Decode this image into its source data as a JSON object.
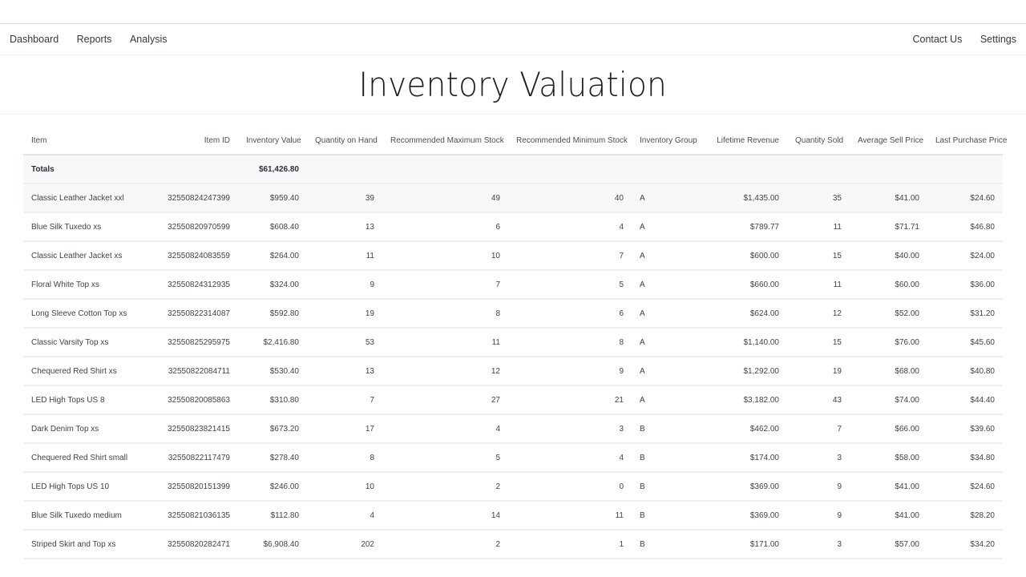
{
  "nav": {
    "left": [
      {
        "label": "Dashboard"
      },
      {
        "label": "Reports"
      },
      {
        "label": "Analysis"
      }
    ],
    "right": [
      {
        "label": "Contact Us"
      },
      {
        "label": "Settings"
      }
    ]
  },
  "page": {
    "title": "Inventory Valuation"
  },
  "table": {
    "columns": [
      "Item",
      "Item ID",
      "Inventory Value",
      "Quantity on Hand",
      "Recommended Maximum Stock",
      "Recommended Minimum Stock",
      "Inventory Group",
      "Lifetime Revenue",
      "Quantity Sold",
      "Average Sell Price",
      "Last Purchase Price"
    ],
    "totals": {
      "label": "Totals",
      "inventory_value": "$61,426.80"
    },
    "rows": [
      {
        "item": "Classic Leather Jacket xxl",
        "item_id": "32550824247399",
        "inventory_value": "$959.40",
        "qty_on_hand": "39",
        "rec_max": "49",
        "rec_min": "40",
        "group": "A",
        "lifetime_revenue": "$1,435.00",
        "qty_sold": "35",
        "avg_sell": "$41.00",
        "last_purchase": "$24.60"
      },
      {
        "item": "Blue Silk Tuxedo xs",
        "item_id": "32550820970599",
        "inventory_value": "$608.40",
        "qty_on_hand": "13",
        "rec_max": "6",
        "rec_min": "4",
        "group": "A",
        "lifetime_revenue": "$789.77",
        "qty_sold": "11",
        "avg_sell": "$71.71",
        "last_purchase": "$46.80"
      },
      {
        "item": "Classic Leather Jacket xs",
        "item_id": "32550824083559",
        "inventory_value": "$264.00",
        "qty_on_hand": "11",
        "rec_max": "10",
        "rec_min": "7",
        "group": "A",
        "lifetime_revenue": "$600.00",
        "qty_sold": "15",
        "avg_sell": "$40.00",
        "last_purchase": "$24.00"
      },
      {
        "item": "Floral White Top xs",
        "item_id": "32550824312935",
        "inventory_value": "$324.00",
        "qty_on_hand": "9",
        "rec_max": "7",
        "rec_min": "5",
        "group": "A",
        "lifetime_revenue": "$660.00",
        "qty_sold": "11",
        "avg_sell": "$60.00",
        "last_purchase": "$36.00"
      },
      {
        "item": "Long Sleeve Cotton Top xs",
        "item_id": "32550822314087",
        "inventory_value": "$592.80",
        "qty_on_hand": "19",
        "rec_max": "8",
        "rec_min": "6",
        "group": "A",
        "lifetime_revenue": "$624.00",
        "qty_sold": "12",
        "avg_sell": "$52.00",
        "last_purchase": "$31.20"
      },
      {
        "item": "Classic Varsity Top xs",
        "item_id": "32550825295975",
        "inventory_value": "$2,416.80",
        "qty_on_hand": "53",
        "rec_max": "11",
        "rec_min": "8",
        "group": "A",
        "lifetime_revenue": "$1,140.00",
        "qty_sold": "15",
        "avg_sell": "$76.00",
        "last_purchase": "$45.60"
      },
      {
        "item": "Chequered Red Shirt xs",
        "item_id": "32550822084711",
        "inventory_value": "$530.40",
        "qty_on_hand": "13",
        "rec_max": "12",
        "rec_min": "9",
        "group": "A",
        "lifetime_revenue": "$1,292.00",
        "qty_sold": "19",
        "avg_sell": "$68.00",
        "last_purchase": "$40.80"
      },
      {
        "item": "LED High Tops US 8",
        "item_id": "32550820085863",
        "inventory_value": "$310.80",
        "qty_on_hand": "7",
        "rec_max": "27",
        "rec_min": "21",
        "group": "A",
        "lifetime_revenue": "$3,182.00",
        "qty_sold": "43",
        "avg_sell": "$74.00",
        "last_purchase": "$44.40"
      },
      {
        "item": "Dark Denim Top xs",
        "item_id": "32550823821415",
        "inventory_value": "$673.20",
        "qty_on_hand": "17",
        "rec_max": "4",
        "rec_min": "3",
        "group": "B",
        "lifetime_revenue": "$462.00",
        "qty_sold": "7",
        "avg_sell": "$66.00",
        "last_purchase": "$39.60"
      },
      {
        "item": "Chequered Red Shirt small",
        "item_id": "32550822117479",
        "inventory_value": "$278.40",
        "qty_on_hand": "8",
        "rec_max": "5",
        "rec_min": "4",
        "group": "B",
        "lifetime_revenue": "$174.00",
        "qty_sold": "3",
        "avg_sell": "$58.00",
        "last_purchase": "$34.80"
      },
      {
        "item": "LED High Tops US 10",
        "item_id": "32550820151399",
        "inventory_value": "$246.00",
        "qty_on_hand": "10",
        "rec_max": "2",
        "rec_min": "0",
        "group": "B",
        "lifetime_revenue": "$369.00",
        "qty_sold": "9",
        "avg_sell": "$41.00",
        "last_purchase": "$24.60"
      },
      {
        "item": "Blue Silk Tuxedo medium",
        "item_id": "32550821036135",
        "inventory_value": "$112.80",
        "qty_on_hand": "4",
        "rec_max": "14",
        "rec_min": "11",
        "group": "B",
        "lifetime_revenue": "$369.00",
        "qty_sold": "9",
        "avg_sell": "$41.00",
        "last_purchase": "$28.20"
      },
      {
        "item": "Striped Skirt and Top xs",
        "item_id": "32550820282471",
        "inventory_value": "$6,908.40",
        "qty_on_hand": "202",
        "rec_max": "2",
        "rec_min": "1",
        "group": "B",
        "lifetime_revenue": "$171.00",
        "qty_sold": "3",
        "avg_sell": "$57.00",
        "last_purchase": "$34.20"
      }
    ]
  }
}
